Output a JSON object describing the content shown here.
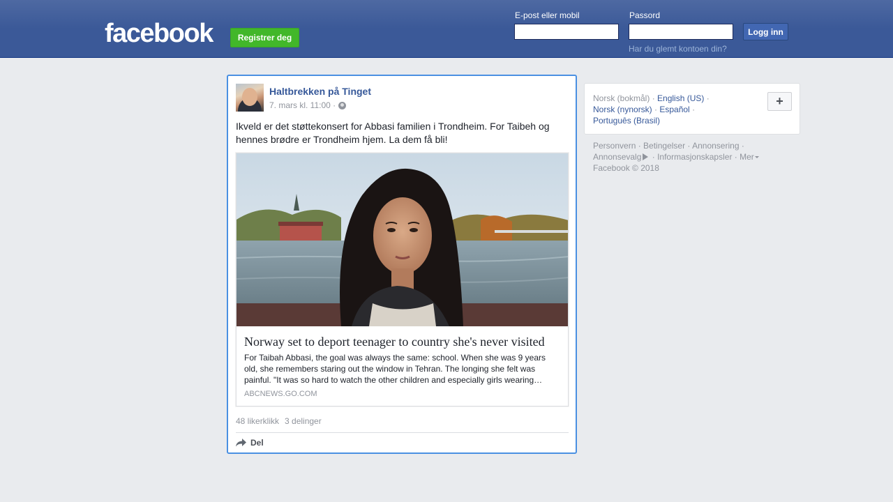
{
  "header": {
    "logo": "facebook",
    "register_label": "Registrer deg",
    "email_label": "E-post eller mobil",
    "email_value": "",
    "password_label": "Passord",
    "password_value": "",
    "login_label": "Logg inn",
    "forgot_label": "Har du glemt kontoen din?"
  },
  "post": {
    "author": "Haltbrekken på Tinget",
    "timestamp": "7. mars kl. 11:00 ·",
    "text": "Ikveld er det støttekonsert for Abbasi familien i Trondheim. For Taibeh og hennes brødre er Trondheim hjem. La dem få bli!",
    "link": {
      "title": "Norway set to deport teenager to country she's never visited",
      "description": "For Taibah Abbasi, the goal was always the same: school. When she was 9 years old, she remembers staring out the window in Tehran. The longing she felt was painful. \"It was so hard to watch the other children and especially girls wearing…",
      "domain": "ABCNEWS.GO.COM"
    },
    "likes": "48 likerklikk",
    "shares": "3 delinger",
    "share_label": "Del"
  },
  "languages": {
    "current": "Norsk (bokmål)",
    "options": [
      "English (US)",
      "Norsk (nynorsk)",
      "Español",
      "Português (Brasil)"
    ],
    "more_label": "+"
  },
  "footer": {
    "links": [
      "Personvern",
      "Betingelser",
      "Annonsering",
      "Annonsevalg",
      "Informasjonskapsler",
      "Mer"
    ],
    "copyright": "Facebook © 2018"
  },
  "colors": {
    "brand_blue": "#3b5998",
    "link_blue": "#365899",
    "register_green": "#42b72a",
    "focus_border": "#4a90e2"
  }
}
